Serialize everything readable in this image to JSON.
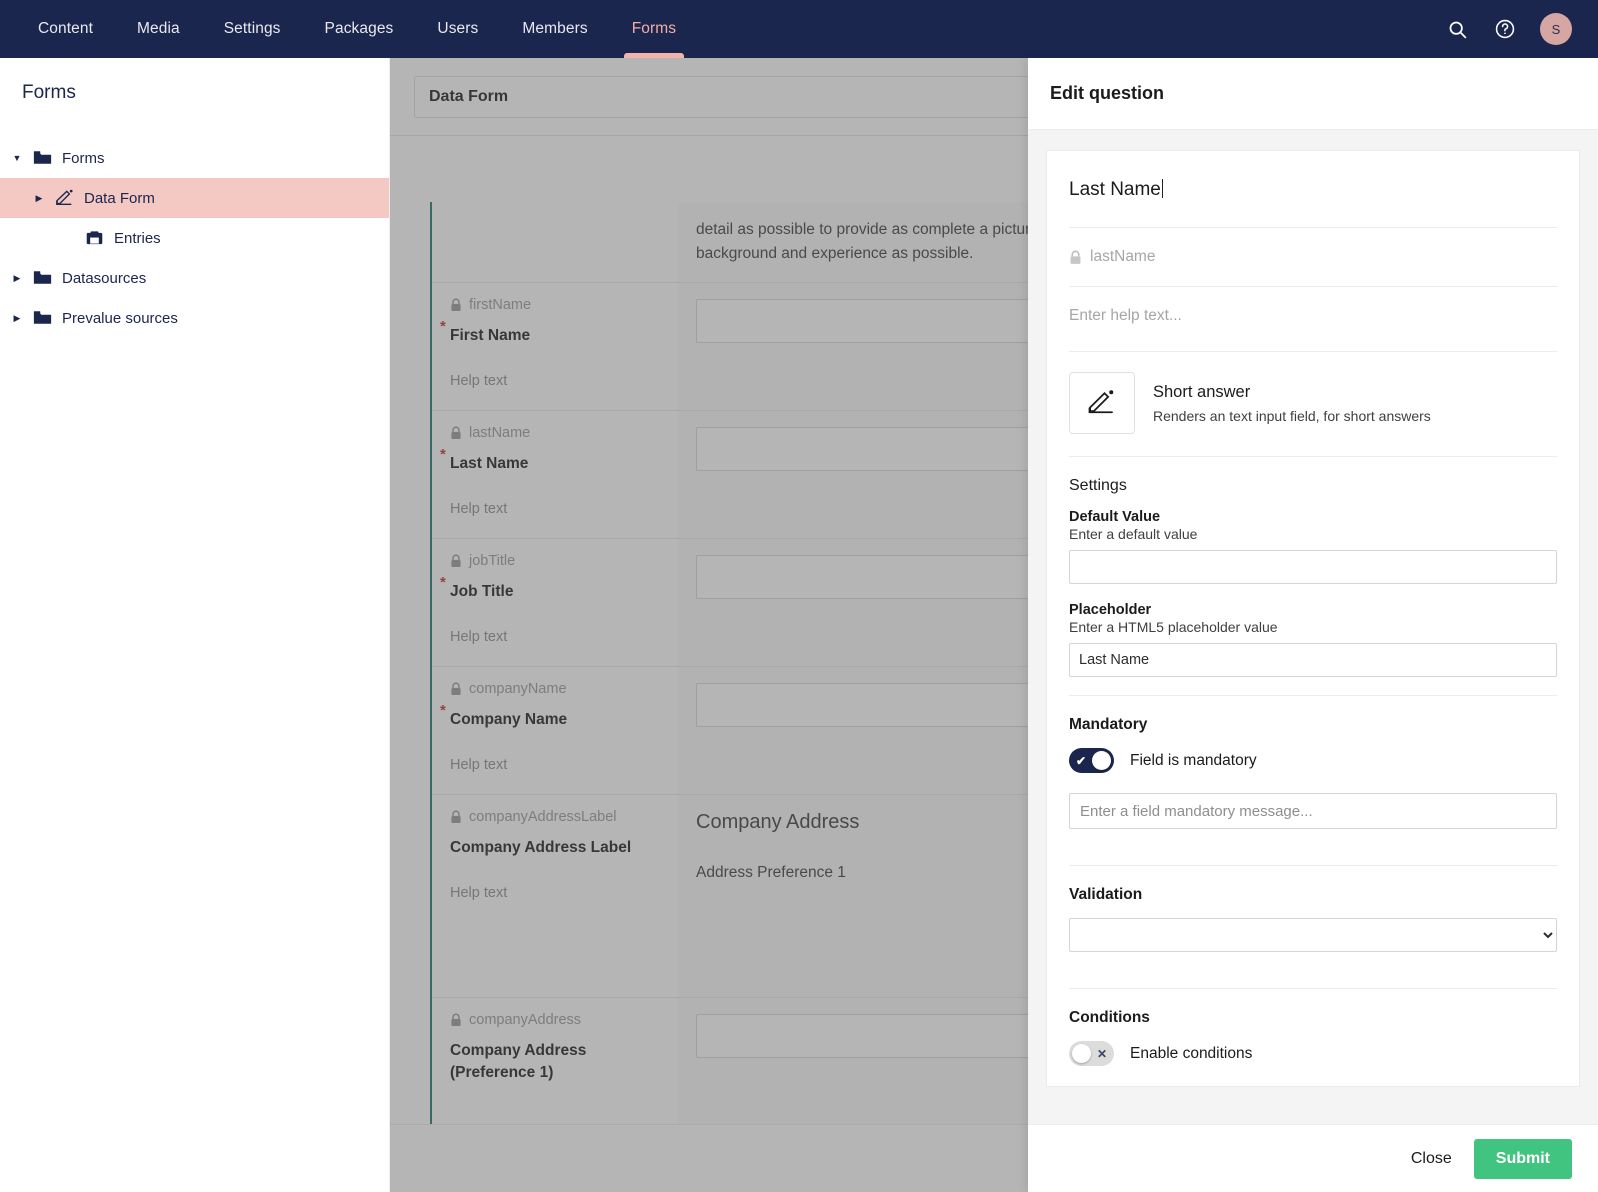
{
  "topbar": {
    "sections": [
      {
        "label": "Content",
        "active": false
      },
      {
        "label": "Media",
        "active": false
      },
      {
        "label": "Settings",
        "active": false
      },
      {
        "label": "Packages",
        "active": false
      },
      {
        "label": "Users",
        "active": false
      },
      {
        "label": "Members",
        "active": false
      },
      {
        "label": "Forms",
        "active": true
      }
    ],
    "search_icon": "search-icon",
    "help_icon": "help-icon",
    "avatar_initial": "S",
    "background_color": "#1b264f",
    "active_color": "#f3aea7"
  },
  "tree": {
    "title": "Forms",
    "items": [
      {
        "label": "Forms",
        "level": 1,
        "icon": "folder-icon",
        "caret": "collapsed-down",
        "selected": false
      },
      {
        "label": "Data Form",
        "level": 2,
        "icon": "form-edit-icon",
        "caret": "collapsed-right",
        "selected": true
      },
      {
        "label": "Entries",
        "level": 3,
        "icon": "entries-icon",
        "caret": "none",
        "selected": false
      },
      {
        "label": "Datasources",
        "level": 1,
        "icon": "folder-icon",
        "caret": "collapsed-right",
        "selected": false
      },
      {
        "label": "Prevalue sources",
        "level": 1,
        "icon": "folder-icon",
        "caret": "collapsed-right",
        "selected": false
      }
    ],
    "selected_color": "#f5c9c3"
  },
  "builder": {
    "form_name": "Data Form",
    "intro_text": "detail as possible to provide as complete a picture\nbackground and experience as possible.",
    "group_accent_color": "#1a7a6d",
    "rows": [
      {
        "alias": "firstName",
        "label": "First Name",
        "required": true,
        "help_text": "Help text",
        "preview_type": "input"
      },
      {
        "alias": "lastName",
        "label": "Last Name",
        "required": true,
        "help_text": "Help text",
        "preview_type": "input"
      },
      {
        "alias": "jobTitle",
        "label": "Job Title",
        "required": true,
        "help_text": "Help text",
        "preview_type": "input"
      },
      {
        "alias": "companyName",
        "label": "Company Name",
        "required": true,
        "help_text": "Help text",
        "preview_type": "input"
      },
      {
        "alias": "companyAddressLabel",
        "label": "Company Address Label",
        "required": false,
        "help_text": "Help text",
        "preview_type": "heading",
        "preview_heading": "Company Address",
        "preview_sub": "Address Preference 1"
      },
      {
        "alias": "companyAddress",
        "label": "Company Address (Preference 1)",
        "required": false,
        "help_text": "",
        "preview_type": "input"
      }
    ]
  },
  "panel": {
    "header_title": "Edit question",
    "question_caption": "Last Name",
    "question_alias": "lastName",
    "help_placeholder": "Enter help text...",
    "field_type": {
      "name": "Short answer",
      "description": "Renders an text input field, for short answers",
      "icon": "short-answer-pencil-icon"
    },
    "settings_title": "Settings",
    "settings": [
      {
        "name": "Default Value",
        "description": "Enter a default value",
        "value": "",
        "placeholder": ""
      },
      {
        "name": "Placeholder",
        "description": "Enter a HTML5 placeholder value",
        "value": "Last Name",
        "placeholder": ""
      }
    ],
    "mandatory": {
      "title": "Mandatory",
      "toggle_label": "Field is mandatory",
      "enabled": true,
      "message_placeholder": "Enter a field mandatory message...",
      "message_value": ""
    },
    "validation": {
      "title": "Validation",
      "selected_option": "",
      "options": [
        ""
      ]
    },
    "conditions": {
      "title": "Conditions",
      "toggle_label": "Enable conditions",
      "enabled": false
    },
    "footer": {
      "close_label": "Close",
      "submit_label": "Submit",
      "submit_color": "#41c47f"
    }
  }
}
